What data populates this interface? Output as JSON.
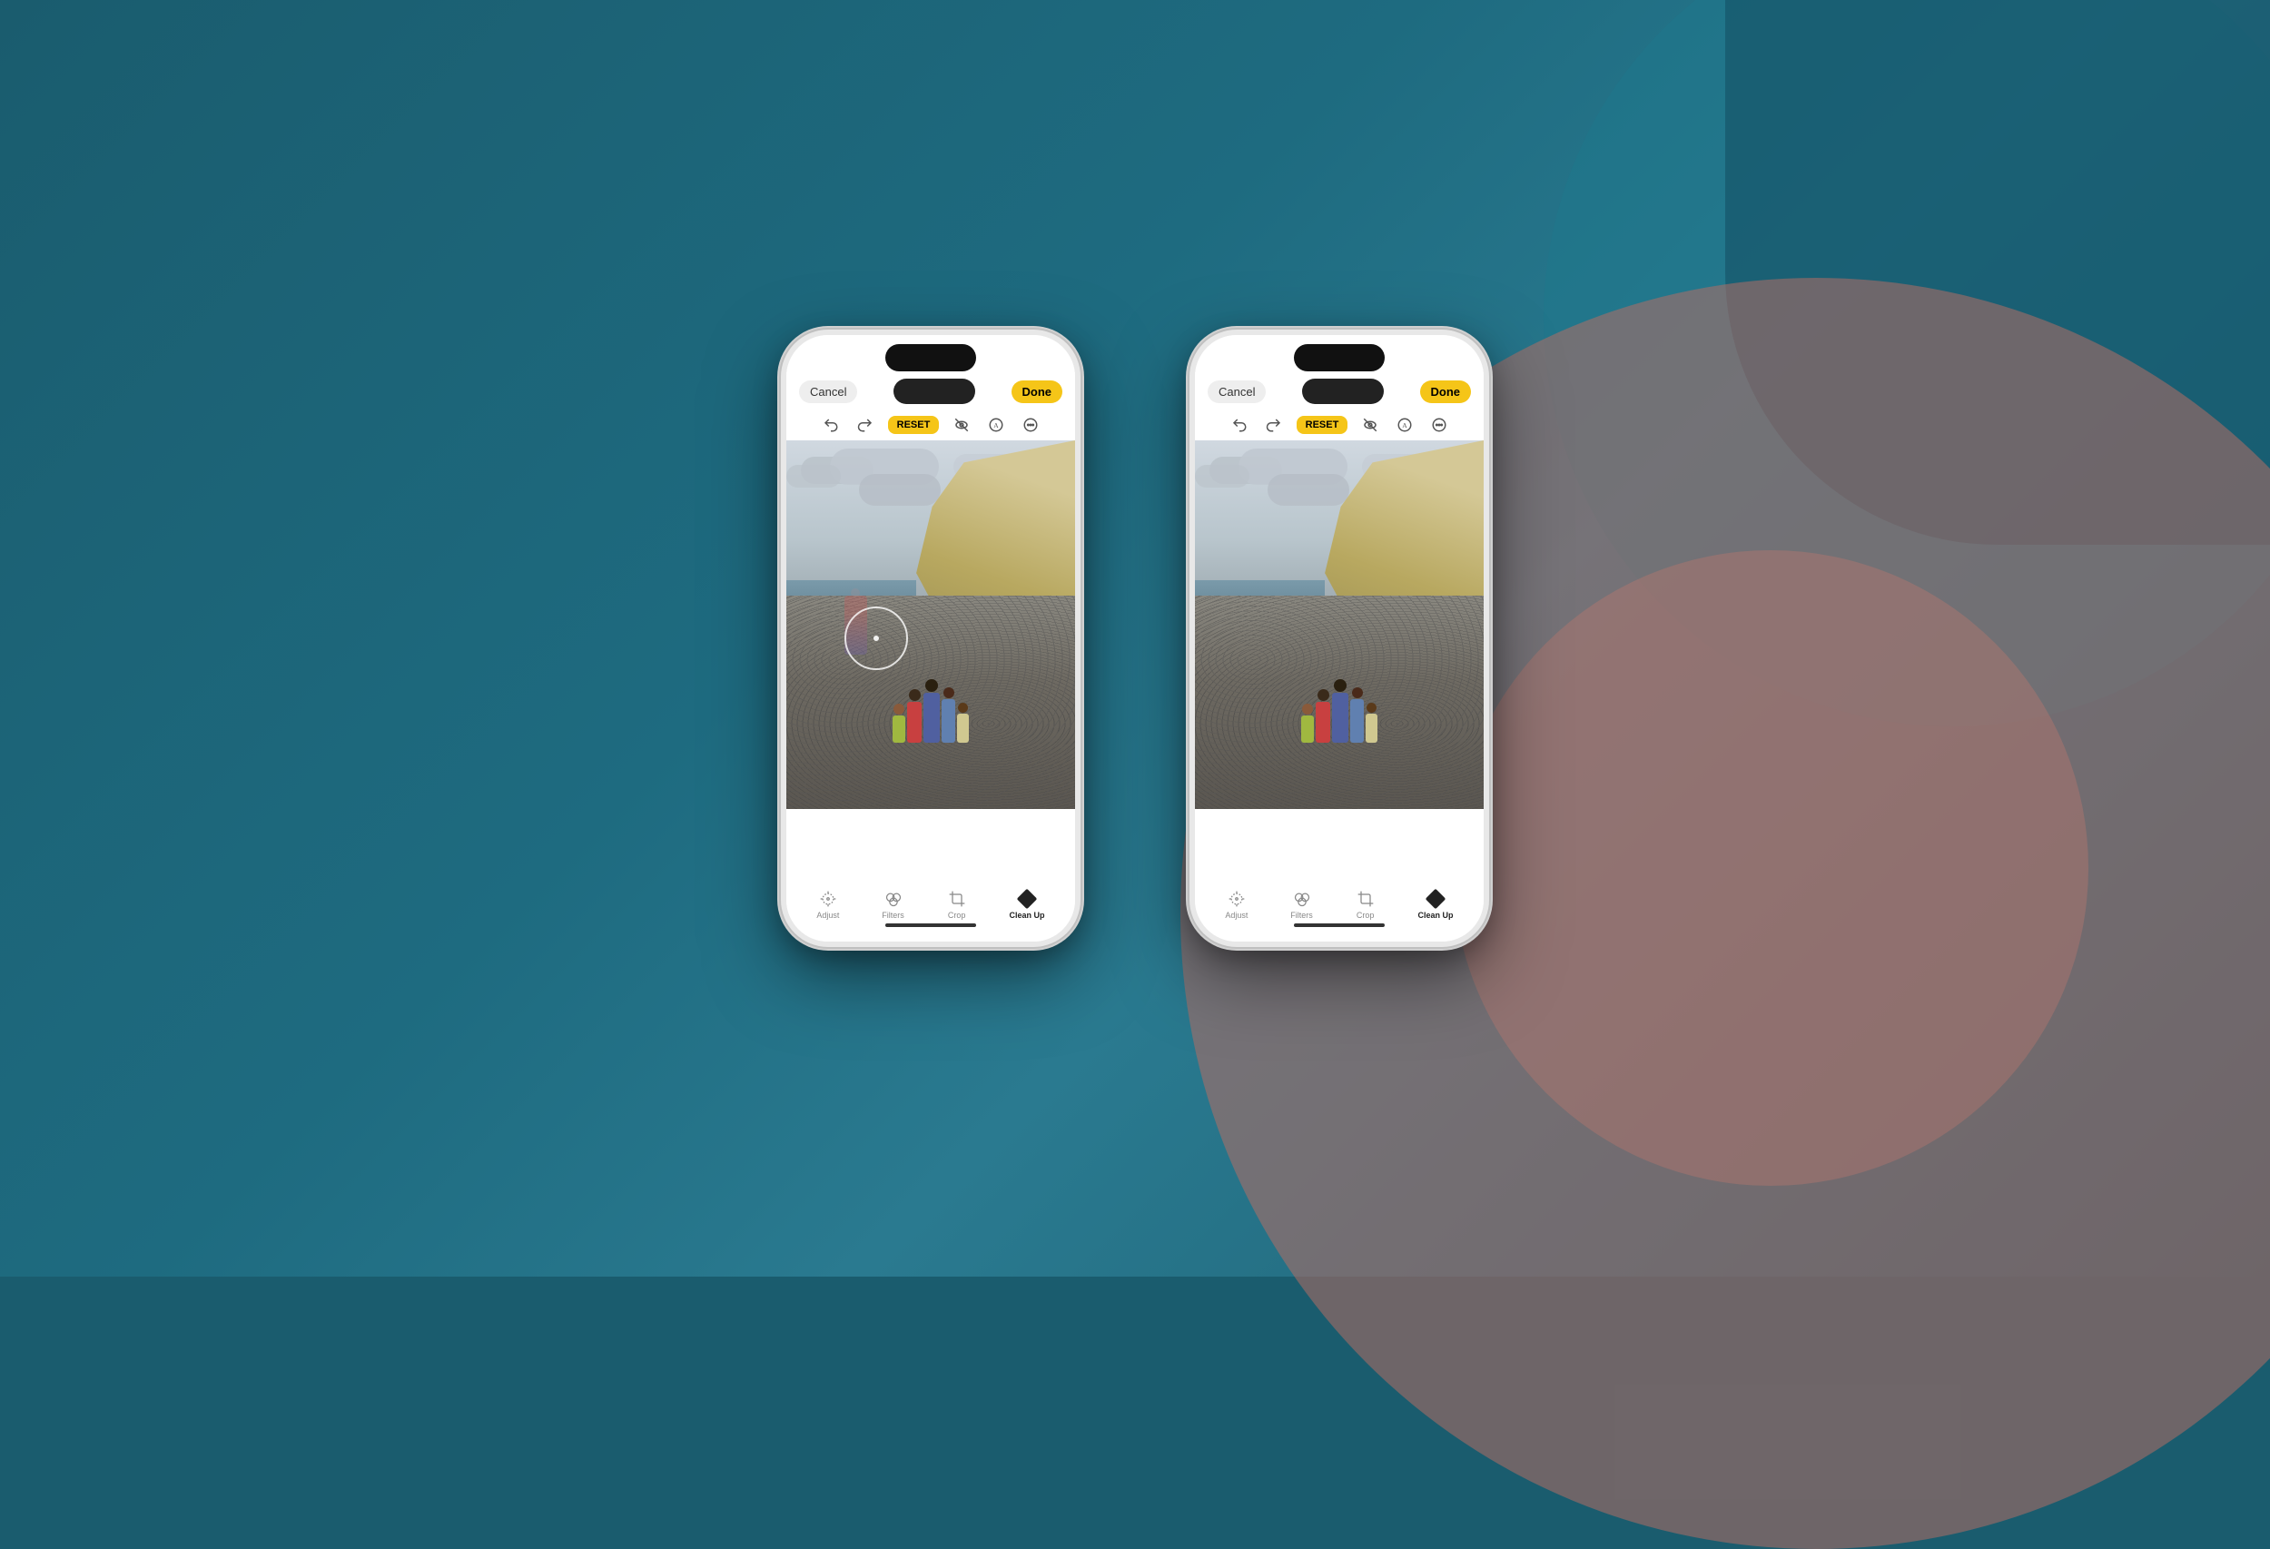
{
  "background": {
    "color_main": "#1a5c6e",
    "color_teal": "#1e7080",
    "color_pink": "#b46e64"
  },
  "phone_left": {
    "cancel_label": "Cancel",
    "done_label": "Done",
    "reset_label": "RESET",
    "tabs": [
      {
        "id": "adjust",
        "label": "Adjust",
        "active": false
      },
      {
        "id": "filters",
        "label": "Filters",
        "active": false
      },
      {
        "id": "crop",
        "label": "Crop",
        "active": false
      },
      {
        "id": "cleanup",
        "label": "Clean Up",
        "active": true
      }
    ],
    "has_brush": true
  },
  "phone_right": {
    "cancel_label": "Cancel",
    "done_label": "Done",
    "reset_label": "RESET",
    "tabs": [
      {
        "id": "adjust",
        "label": "Adjust",
        "active": false
      },
      {
        "id": "filters",
        "label": "Filters",
        "active": false
      },
      {
        "id": "crop",
        "label": "Crop",
        "active": false
      },
      {
        "id": "cleanup",
        "label": "Clean Up",
        "active": true
      }
    ],
    "has_brush": false
  },
  "icons": {
    "undo": "↩",
    "redo": "↪",
    "visibility": "👁",
    "text": "A",
    "more": "•••"
  }
}
